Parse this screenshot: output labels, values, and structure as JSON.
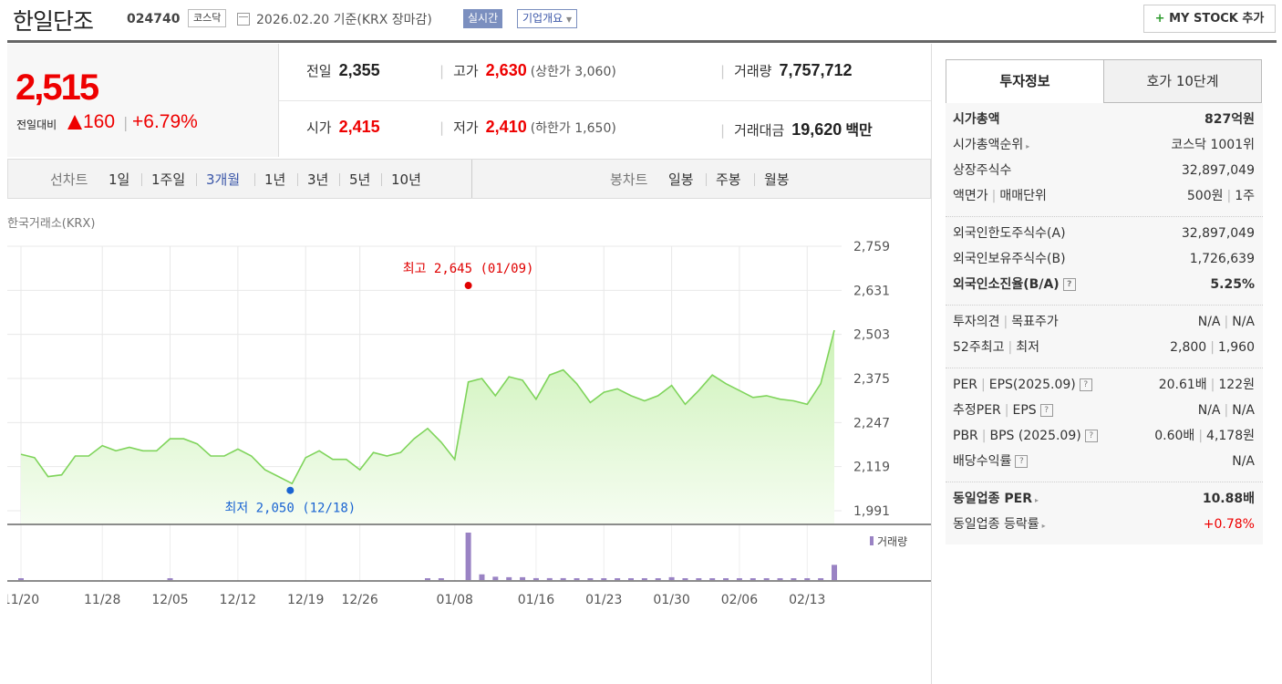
{
  "header": {
    "company_name": "한일단조",
    "stock_code": "024740",
    "market": "코스닥",
    "date_text": "2026.02.20 기준(KRX 장마감)",
    "realtime_label": "실시간",
    "company_info_label": "기업개요",
    "mystock_plus": "+",
    "mystock_label": "MY STOCK 추가"
  },
  "price": {
    "current": "2,515",
    "change_label": "전일대비",
    "change": "160",
    "change_sep": "|",
    "change_pct": "+6.79%"
  },
  "quote": {
    "prev_label": "전일",
    "prev": "2,355",
    "high_label": "고가",
    "high": "2,630",
    "upper_limit": "(상한가 3,060)",
    "volume_label": "거래량",
    "volume": "7,757,712",
    "open_label": "시가",
    "open": "2,415",
    "low_label": "저가",
    "low": "2,410",
    "lower_limit": "(하한가 1,650)",
    "amount_label": "거래대금",
    "amount": "19,620",
    "amount_unit": "백만",
    "sep": "|"
  },
  "period_bar": {
    "line_label": "선차트",
    "periods": [
      "1일",
      "1주일",
      "3개월",
      "1년",
      "3년",
      "5년",
      "10년"
    ],
    "active_period": "3개월",
    "candle_label": "봉차트",
    "candles": [
      "일봉",
      "주봉",
      "월봉"
    ]
  },
  "chart_data": {
    "type": "area",
    "source_label": "한국거래소(KRX)",
    "x": [
      "11/20",
      "11/21",
      "11/24",
      "11/25",
      "11/26",
      "11/27",
      "11/28",
      "12/01",
      "12/02",
      "12/03",
      "12/04",
      "12/05",
      "12/08",
      "12/09",
      "12/10",
      "12/11",
      "12/12",
      "12/15",
      "12/16",
      "12/17",
      "12/18",
      "12/19",
      "12/22",
      "12/23",
      "12/24",
      "12/26",
      "12/29",
      "12/30",
      "01/02",
      "01/05",
      "01/06",
      "01/07",
      "01/08",
      "01/09",
      "01/12",
      "01/13",
      "01/14",
      "01/15",
      "01/16",
      "01/19",
      "01/20",
      "01/21",
      "01/22",
      "01/23",
      "01/26",
      "01/27",
      "01/28",
      "01/29",
      "01/30",
      "02/02",
      "02/03",
      "02/04",
      "02/05",
      "02/06",
      "02/09",
      "02/10",
      "02/11",
      "02/12",
      "02/13",
      "02/19",
      "02/20"
    ],
    "close": [
      2155,
      2145,
      2090,
      2095,
      2150,
      2150,
      2180,
      2165,
      2175,
      2165,
      2165,
      2200,
      2200,
      2185,
      2150,
      2150,
      2170,
      2150,
      2110,
      2090,
      2070,
      2145,
      2165,
      2140,
      2140,
      2110,
      2160,
      2150,
      2160,
      2200,
      2230,
      2190,
      2140,
      2365,
      2375,
      2325,
      2380,
      2370,
      2315,
      2385,
      2400,
      2360,
      2305,
      2335,
      2345,
      2325,
      2310,
      2325,
      2355,
      2300,
      2340,
      2385,
      2360,
      2340,
      2320,
      2325,
      2315,
      2310,
      2300,
      2360,
      2515
    ],
    "volume": [
      0.02,
      0,
      0,
      0,
      0,
      0,
      0,
      0,
      0,
      0,
      0,
      0.02,
      0,
      0,
      0,
      0,
      0,
      0,
      0,
      0,
      0,
      0,
      0,
      0,
      0,
      0,
      0,
      0,
      0,
      0,
      0.02,
      0.02,
      0,
      1.0,
      0.12,
      0.07,
      0.06,
      0.06,
      0.04,
      0.04,
      0.04,
      0.03,
      0.02,
      0.02,
      0.02,
      0.02,
      0.02,
      0.02,
      0.06,
      0.02,
      0.02,
      0.02,
      0.02,
      0.02,
      0.02,
      0.02,
      0.02,
      0.02,
      0.02,
      0.02,
      0.32
    ],
    "y_ticks": [
      "2,759",
      "2,631",
      "2,503",
      "2,375",
      "2,247",
      "2,119",
      "1,991"
    ],
    "ylim": [
      1991,
      2759
    ],
    "x_tick_labels": [
      "11/20",
      "11/28",
      "12/05",
      "12/12",
      "12/19",
      "12/26",
      "01/08",
      "01/16",
      "01/23",
      "01/30",
      "02/06",
      "02/13"
    ],
    "max_label": "최고 2,645 (01/09)",
    "min_label": "최저 2,050 (12/18)",
    "max_value": 2645,
    "min_value": 2050,
    "volume_legend": "거래량",
    "line_color": "#7fd45b",
    "fill_color": "#e6f8dc",
    "volume_color": "#9a83c4",
    "max_color": "#e00000",
    "min_color": "#1a64d2"
  },
  "sidebar": {
    "tab_invest": "투자정보",
    "tab_quote10": "호가 10단계",
    "s1": [
      {
        "k": "시가총액",
        "v": "827억원",
        "bold": true
      },
      {
        "k": "시가총액순위",
        "v": "코스닥 1001위",
        "arrow": true
      },
      {
        "k": "상장주식수",
        "v": "32,897,049"
      },
      {
        "k": "액면가",
        "k2": "매매단위",
        "v": "500원",
        "v2": "1주"
      }
    ],
    "s2": [
      {
        "k": "외국인한도주식수(A)",
        "v": "32,897,049"
      },
      {
        "k": "외국인보유주식수(B)",
        "v": "1,726,639"
      },
      {
        "k": "외국인소진율(B/A)",
        "v": "5.25%",
        "bold": true,
        "help": true
      }
    ],
    "s3": [
      {
        "k": "투자의견",
        "k2": "목표주가",
        "v": "N/A",
        "v2": "N/A"
      },
      {
        "k": "52주최고",
        "k2": "최저",
        "v": "2,800",
        "v2": "1,960"
      }
    ],
    "s4": [
      {
        "k": "PER",
        "k2": "EPS(2025.09)",
        "v": "20.61배",
        "v2": "122원",
        "help": true
      },
      {
        "k": "추정PER",
        "k2": "EPS",
        "v": "N/A",
        "v2": "N/A",
        "help": true
      },
      {
        "k": "PBR",
        "k2": "BPS (2025.09)",
        "v": "0.60배",
        "v2": "4,178원",
        "help": true
      },
      {
        "k": "배당수익률",
        "v": "N/A",
        "help": true
      }
    ],
    "s5": [
      {
        "k": "동일업종 PER",
        "v": "10.88배",
        "bold": true,
        "arrow": true
      },
      {
        "k": "동일업종 등락률",
        "v": "+0.78%",
        "arrow": true,
        "red": true
      }
    ],
    "help_glyph": "?",
    "arrow_glyph": "▸",
    "sep": "|"
  }
}
